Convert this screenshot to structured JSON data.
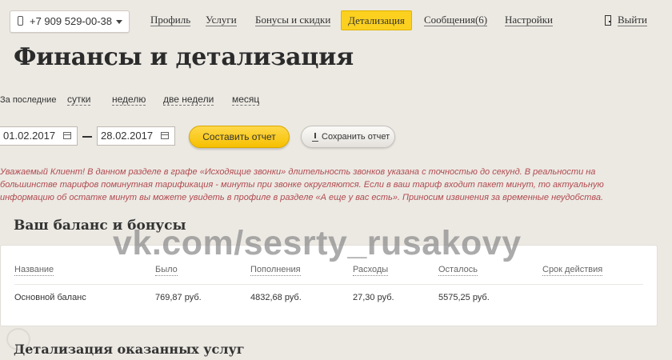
{
  "header": {
    "phone": "+7 909 529-00-38",
    "nav": [
      {
        "label": "Профиль"
      },
      {
        "label": "Услуги"
      },
      {
        "label": "Бонусы и скидки"
      },
      {
        "label": "Детализация",
        "active": true
      },
      {
        "label": "Сообщения(6)"
      },
      {
        "label": "Настройки"
      }
    ],
    "logout": "Выйти"
  },
  "page": {
    "title": "Финансы и детализация"
  },
  "period": {
    "label": "За последние",
    "options": [
      "сутки",
      "неделю",
      "две недели",
      "месяц"
    ]
  },
  "dates": {
    "from": "01.02.2017",
    "to": "28.02.2017"
  },
  "buttons": {
    "report": "Составить отчет",
    "save": "Сохранить отчет"
  },
  "notice": {
    "lines": [
      "Уважаемый Клиент! В данном разделе в графе «Исходящие звонки» длительность звонков указана с точностью до секунд. В реальности на",
      "большинстве тарифов поминутная тарификация - минуты при звонке округляются. Если в ваш тариф входит пакет минут, то актуальную",
      "информацию об остатке минут вы можете увидеть в профиле в разделе «А еще у вас есть». Приносим извинения за временные неудобства."
    ]
  },
  "balance": {
    "title": "Ваш баланс и бонусы",
    "columns": [
      "Название",
      "Было",
      "Пополнения",
      "Расходы",
      "Осталось",
      "Срок действия"
    ],
    "rows": [
      [
        "Основной баланс",
        "769,87 руб.",
        "4832,68 руб.",
        "27,30 руб.",
        "5575,25 руб.",
        ""
      ]
    ]
  },
  "details": {
    "title": "Детализация оказанных услуг"
  },
  "watermark": "vk.com/sesrty_rusakovy",
  "colors": {
    "accent": "#fbd01f",
    "notice": "#b04a4f",
    "background": "#ece9e3"
  }
}
